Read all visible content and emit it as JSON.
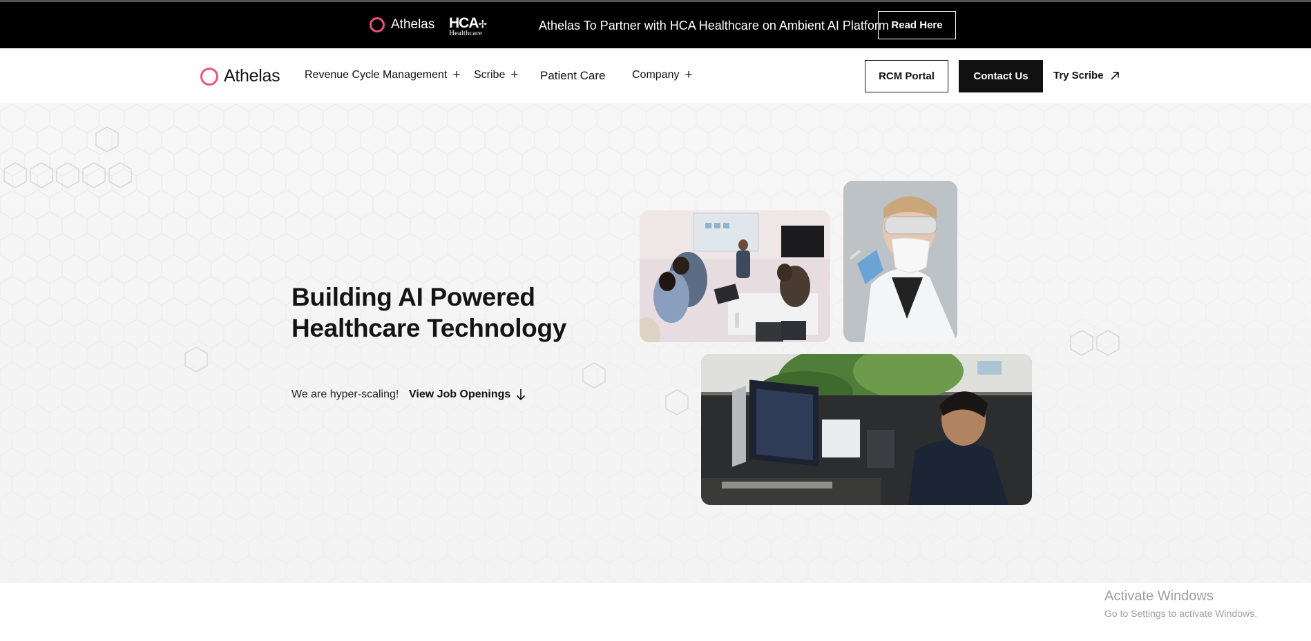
{
  "announcement": {
    "brand": "Athelas",
    "partner_logo_top": "HCA",
    "partner_logo_bottom": "Healthcare",
    "headline": "Athelas To Partner with HCA Healthcare on Ambient AI Platform",
    "cta": "Read Here"
  },
  "nav": {
    "brand": "Athelas",
    "items": [
      {
        "label": "Revenue Cycle Management",
        "has_dropdown": true
      },
      {
        "label": "Scribe",
        "has_dropdown": true
      },
      {
        "label": "Patient Care",
        "has_dropdown": false
      },
      {
        "label": "Company",
        "has_dropdown": true
      }
    ],
    "plus_glyph": "+",
    "rcm_portal": "RCM Portal",
    "contact": "Contact Us",
    "try_scribe": "Try Scribe"
  },
  "hero": {
    "title_line1": "Building AI Powered",
    "title_line2": "Healthcare Technology",
    "tagline": "We are hyper-scaling!",
    "jobs_link": "View Job Openings",
    "photos": [
      "team-meeting-photo",
      "lab-researcher-photo",
      "engineer-at-desk-photo"
    ]
  },
  "watermark": {
    "line1": "Activate Windows",
    "line2": "Go to Settings to activate Windows."
  },
  "colors": {
    "brand_accent": "#f0517a",
    "announce_bg": "#000000",
    "hero_bg": "#f5f5f5",
    "dark_button": "#111111"
  }
}
